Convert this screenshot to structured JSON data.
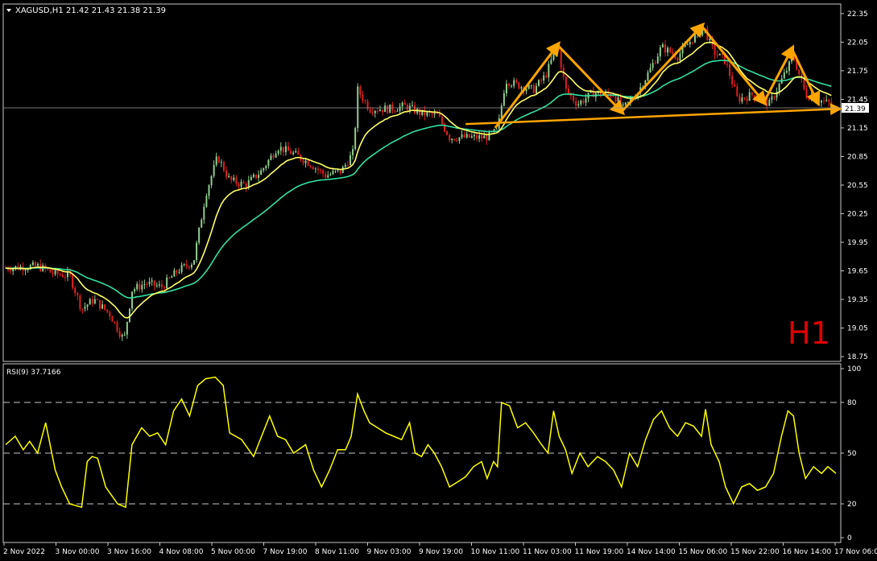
{
  "main_panel": {
    "symbol_header": "XAGUSD,H1",
    "ohlc_header": "21.42 21.43 21.38 21.39",
    "timeframe_watermark": "H1",
    "price_ticks": [
      "22.35",
      "22.05",
      "21.75",
      "21.45",
      "21.15",
      "20.85",
      "20.55",
      "20.25",
      "19.95",
      "19.65",
      "19.35",
      "19.05",
      "18.75"
    ],
    "current_price_label": "21.39"
  },
  "rsi_panel": {
    "header": "RSI(9) 37.7166",
    "ticks": [
      "100",
      "80",
      "50",
      "20",
      "0"
    ],
    "levels": [
      80,
      50,
      20
    ]
  },
  "x_axis_labels": [
    "2 Nov 2022",
    "3 Nov 00:00",
    "3 Nov 16:00",
    "4 Nov 08:00",
    "5 Nov 00:00",
    "7 Nov 19:00",
    "8 Nov 11:00",
    "9 Nov 03:00",
    "9 Nov 19:00",
    "10 Nov 11:00",
    "11 Nov 03:00",
    "11 Nov 19:00",
    "14 Nov 14:00",
    "15 Nov 06:00",
    "15 Nov 22:00",
    "16 Nov 14:00",
    "17 Nov 06:00"
  ],
  "colors": {
    "background": "#000000",
    "bull_candle": "#8fce8f",
    "bear_candle": "#e02020",
    "fast_ma": "#ffff66",
    "slow_ma": "#33e0a0",
    "rsi_line": "#ffff00",
    "annotation_arrow": "#ffa500",
    "watermark": "#e00000",
    "grid_text": "#ffffff"
  },
  "chart_data": {
    "type": "candlestick",
    "symbol": "XAGUSD",
    "timeframe": "H1",
    "ylim": [
      18.7,
      22.45
    ],
    "current_price": 21.39,
    "close_path": [
      [
        0,
        19.68
      ],
      [
        40,
        19.7
      ],
      [
        60,
        19.62
      ],
      [
        80,
        19.6
      ],
      [
        95,
        19.25
      ],
      [
        110,
        19.35
      ],
      [
        130,
        19.2
      ],
      [
        148,
        18.92
      ],
      [
        158,
        19.45
      ],
      [
        175,
        19.52
      ],
      [
        195,
        19.48
      ],
      [
        215,
        19.65
      ],
      [
        235,
        19.75
      ],
      [
        250,
        20.45
      ],
      [
        265,
        20.85
      ],
      [
        280,
        20.6
      ],
      [
        300,
        20.55
      ],
      [
        320,
        20.7
      ],
      [
        340,
        20.95
      ],
      [
        360,
        20.88
      ],
      [
        380,
        20.78
      ],
      [
        400,
        20.65
      ],
      [
        420,
        20.7
      ],
      [
        435,
        20.9
      ],
      [
        440,
        21.55
      ],
      [
        455,
        21.35
      ],
      [
        480,
        21.35
      ],
      [
        500,
        21.38
      ],
      [
        520,
        21.3
      ],
      [
        540,
        21.28
      ],
      [
        555,
        21.05
      ],
      [
        575,
        21.05
      ],
      [
        600,
        21.05
      ],
      [
        615,
        21.12
      ],
      [
        625,
        21.65
      ],
      [
        640,
        21.6
      ],
      [
        660,
        21.55
      ],
      [
        675,
        21.7
      ],
      [
        690,
        22.02
      ],
      [
        700,
        21.55
      ],
      [
        715,
        21.4
      ],
      [
        735,
        21.52
      ],
      [
        760,
        21.5
      ],
      [
        772,
        21.35
      ],
      [
        790,
        21.52
      ],
      [
        805,
        21.75
      ],
      [
        820,
        22.0
      ],
      [
        840,
        21.9
      ],
      [
        860,
        22.1
      ],
      [
        873,
        22.2
      ],
      [
        885,
        21.95
      ],
      [
        900,
        21.85
      ],
      [
        915,
        21.45
      ],
      [
        935,
        21.5
      ],
      [
        955,
        21.4
      ],
      [
        970,
        21.65
      ],
      [
        985,
        21.9
      ],
      [
        1000,
        21.5
      ],
      [
        1015,
        21.45
      ],
      [
        1035,
        21.39
      ]
    ],
    "series": [
      {
        "name": "RSI(9)",
        "panel": "rsi",
        "last": 37.7166,
        "values": [
          [
            0,
            55
          ],
          [
            12,
            60
          ],
          [
            22,
            52
          ],
          [
            30,
            57
          ],
          [
            40,
            50
          ],
          [
            50,
            68
          ],
          [
            62,
            40
          ],
          [
            70,
            30
          ],
          [
            80,
            20
          ],
          [
            95,
            18
          ],
          [
            102,
            45
          ],
          [
            108,
            48
          ],
          [
            115,
            47
          ],
          [
            125,
            30
          ],
          [
            140,
            20
          ],
          [
            150,
            18
          ],
          [
            158,
            55
          ],
          [
            170,
            65
          ],
          [
            180,
            60
          ],
          [
            190,
            62
          ],
          [
            200,
            55
          ],
          [
            210,
            75
          ],
          [
            220,
            82
          ],
          [
            230,
            72
          ],
          [
            240,
            90
          ],
          [
            250,
            94
          ],
          [
            262,
            95
          ],
          [
            272,
            90
          ],
          [
            280,
            62
          ],
          [
            295,
            58
          ],
          [
            310,
            48
          ],
          [
            320,
            60
          ],
          [
            330,
            72
          ],
          [
            340,
            60
          ],
          [
            350,
            58
          ],
          [
            360,
            50
          ],
          [
            375,
            55
          ],
          [
            385,
            40
          ],
          [
            395,
            30
          ],
          [
            405,
            40
          ],
          [
            415,
            52
          ],
          [
            425,
            52
          ],
          [
            432,
            60
          ],
          [
            440,
            85
          ],
          [
            448,
            75
          ],
          [
            455,
            68
          ],
          [
            465,
            65
          ],
          [
            475,
            62
          ],
          [
            485,
            60
          ],
          [
            495,
            58
          ],
          [
            505,
            68
          ],
          [
            512,
            50
          ],
          [
            520,
            48
          ],
          [
            528,
            55
          ],
          [
            536,
            50
          ],
          [
            545,
            42
          ],
          [
            555,
            30
          ],
          [
            565,
            33
          ],
          [
            575,
            36
          ],
          [
            585,
            42
          ],
          [
            595,
            45
          ],
          [
            602,
            35
          ],
          [
            610,
            45
          ],
          [
            615,
            42
          ],
          [
            620,
            80
          ],
          [
            630,
            78
          ],
          [
            640,
            65
          ],
          [
            650,
            68
          ],
          [
            660,
            62
          ],
          [
            670,
            55
          ],
          [
            678,
            50
          ],
          [
            685,
            75
          ],
          [
            692,
            60
          ],
          [
            700,
            52
          ],
          [
            708,
            38
          ],
          [
            718,
            50
          ],
          [
            728,
            42
          ],
          [
            740,
            48
          ],
          [
            750,
            45
          ],
          [
            760,
            40
          ],
          [
            770,
            30
          ],
          [
            780,
            50
          ],
          [
            790,
            42
          ],
          [
            800,
            58
          ],
          [
            810,
            70
          ],
          [
            820,
            75
          ],
          [
            830,
            65
          ],
          [
            840,
            60
          ],
          [
            850,
            68
          ],
          [
            860,
            66
          ],
          [
            870,
            60
          ],
          [
            875,
            76
          ],
          [
            882,
            55
          ],
          [
            892,
            45
          ],
          [
            900,
            30
          ],
          [
            910,
            20
          ],
          [
            920,
            30
          ],
          [
            930,
            32
          ],
          [
            940,
            28
          ],
          [
            950,
            30
          ],
          [
            960,
            38
          ],
          [
            970,
            60
          ],
          [
            978,
            75
          ],
          [
            985,
            72
          ],
          [
            992,
            50
          ],
          [
            1000,
            35
          ],
          [
            1010,
            42
          ],
          [
            1020,
            38
          ],
          [
            1028,
            42
          ],
          [
            1038,
            38
          ]
        ]
      }
    ],
    "annotations": "orange arrows mark a head-and-shoulders top; orange neckline from ~21.12 to ~21.35"
  }
}
